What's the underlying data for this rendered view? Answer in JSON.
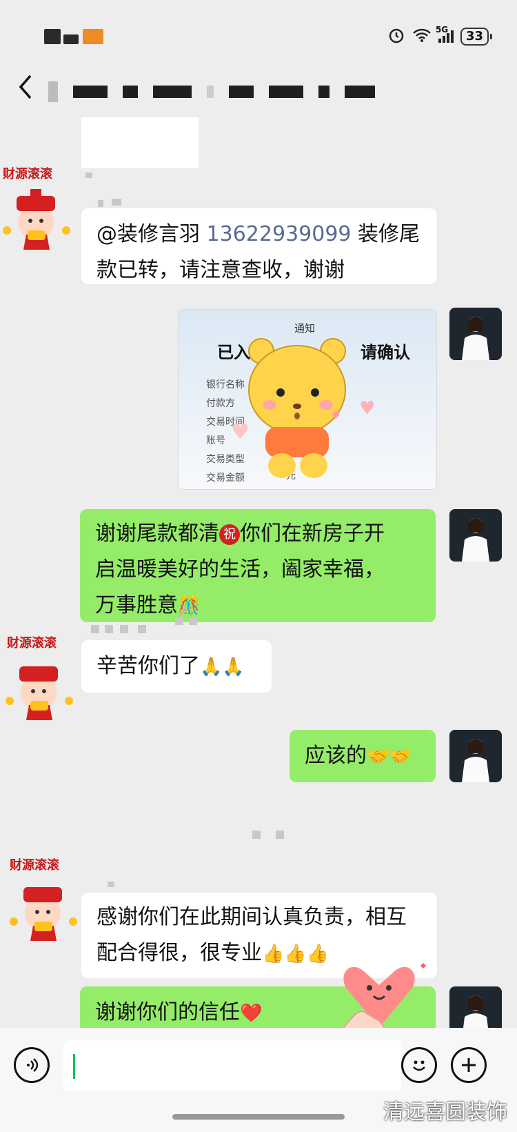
{
  "status_bar": {
    "battery": "33",
    "network": "5G"
  },
  "header": {
    "back_icon": "chevron-left-icon"
  },
  "messages": [
    {
      "id": "m1",
      "side": "left",
      "text": "@装修言羽 13622939099 装修尾款已转，请注意查收，谢谢",
      "line1a": "@装修言羽 ",
      "line1b": "13622939099",
      "line1c": " 装修尾",
      "line2": "款已转，请注意查收，谢谢"
    },
    {
      "id": "m2",
      "side": "right",
      "type": "image",
      "image": {
        "notice": "通知",
        "title_left": "已入则",
        "title_right": "请确认",
        "rows": [
          "银行名称",
          "付款方",
          "交易时间",
          "账号",
          "交易类型",
          "交易金额"
        ],
        "amount_suffix": "元"
      }
    },
    {
      "id": "m3",
      "side": "right",
      "line1a": "谢谢尾款都清",
      "line1b": "你们在新房子开",
      "line2": "启温暖美好的生活，阖家幸福，",
      "line3": "万事胜意",
      "badge": "祝",
      "emoji": "🎊"
    },
    {
      "id": "m4",
      "side": "left",
      "text": "辛苦你们了",
      "emoji": "🙏🙏"
    },
    {
      "id": "m5",
      "side": "right",
      "text": "应该的",
      "emoji": "🤝🤝"
    },
    {
      "id": "m6",
      "side": "left",
      "line1": "感谢你们在此期间认真负责，相互",
      "line2": "配合得很，很专业",
      "emoji": "👍👍👍"
    },
    {
      "id": "m7",
      "side": "right",
      "text": "谢谢你们的信任",
      "emoji": "❤️"
    }
  ],
  "avatar_label": "财源滚滚",
  "input_bar": {
    "voice_icon": "voice-icon",
    "emoji_icon": "smile-icon",
    "plus_icon": "plus-icon"
  },
  "watermark": "清远喜圆装饰"
}
